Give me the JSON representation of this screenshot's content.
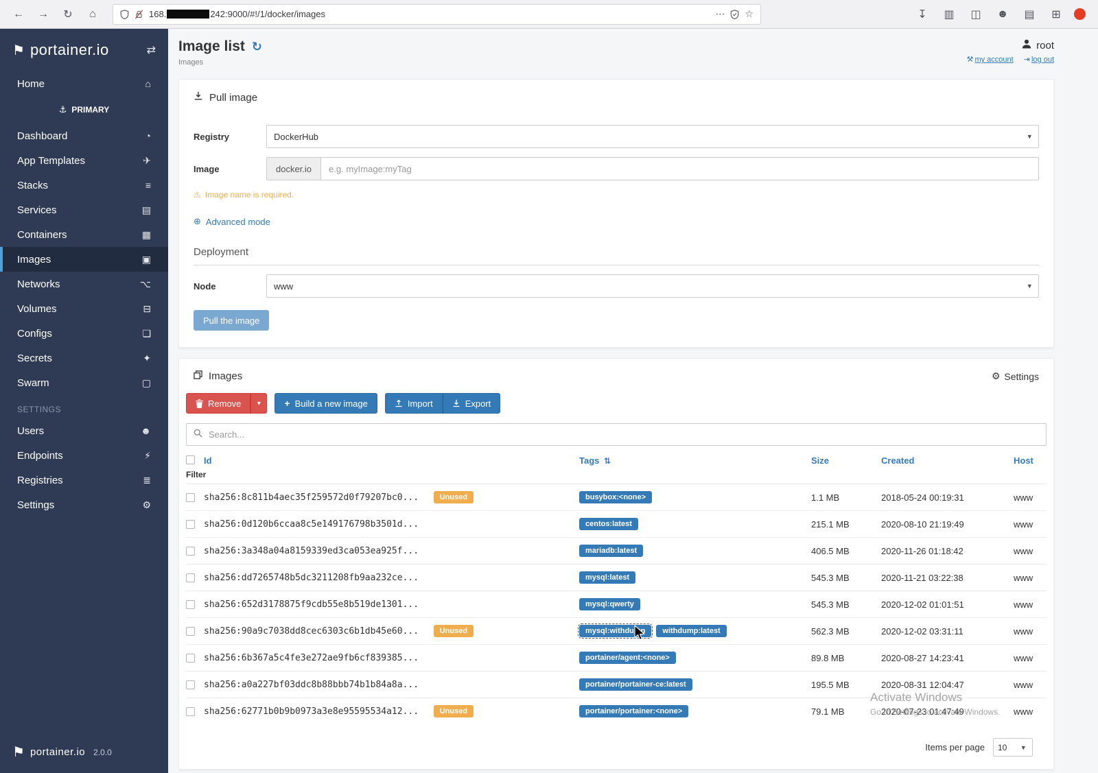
{
  "browser": {
    "url_prefix": "168.",
    "url_suffix": "242:9000/#!/1/docker/images"
  },
  "icons": {
    "back": "←",
    "forward": "→",
    "reload": "↻",
    "nav_home": "⌂",
    "dots": "⋯",
    "star": "☆",
    "downloads": "↧",
    "library": "▥",
    "sidebars": "◫",
    "account": "☻",
    "bookmark": "▤",
    "extensions": "⊞",
    "flag": "⚑",
    "exchange": "⇄",
    "home": "⌂",
    "anchor": "⚓",
    "dashboard": "◔",
    "app_templates": "✈",
    "stacks": "≡",
    "services": "▤",
    "containers": "▦",
    "images": "▣",
    "networks": "⌥",
    "volumes": "⊟",
    "configs": "❏",
    "secrets": "✦",
    "swarm": "▢",
    "users": "☻",
    "endpoints": "⚡",
    "registries": "≣",
    "settings": "⚙",
    "refresh": "↻",
    "wrench": "⚒",
    "logout": "⇥",
    "globe": "⊕",
    "warning": "⚠",
    "gear": "⚙",
    "sort": "⇅",
    "caret": "▾",
    "plus": "+"
  },
  "sidebar": {
    "logo_text": "portainer.io",
    "home_label": "Home",
    "cluster_label": "PRIMARY",
    "menu_items": [
      {
        "label": "Dashboard",
        "icon": "dashboard",
        "active": false
      },
      {
        "label": "App Templates",
        "icon": "app_templates",
        "active": false
      },
      {
        "label": "Stacks",
        "icon": "stacks",
        "active": false
      },
      {
        "label": "Services",
        "icon": "services",
        "active": false
      },
      {
        "label": "Containers",
        "icon": "containers",
        "active": false
      },
      {
        "label": "Images",
        "icon": "images",
        "active": true
      },
      {
        "label": "Networks",
        "icon": "networks",
        "active": false
      },
      {
        "label": "Volumes",
        "icon": "volumes",
        "active": false
      },
      {
        "label": "Configs",
        "icon": "configs",
        "active": false
      },
      {
        "label": "Secrets",
        "icon": "secrets",
        "active": false
      },
      {
        "label": "Swarm",
        "icon": "swarm",
        "active": false
      }
    ],
    "settings_header": "SETTINGS",
    "settings_items": [
      {
        "label": "Users",
        "icon": "users",
        "active": false
      },
      {
        "label": "Endpoints",
        "icon": "endpoints",
        "active": false
      },
      {
        "label": "Registries",
        "icon": "registries",
        "active": false
      },
      {
        "label": "Settings",
        "icon": "settings",
        "active": false
      }
    ],
    "footer_logo_text": "portainer.io",
    "version": "2.0.0"
  },
  "header": {
    "title": "Image list",
    "breadcrumb": "Images",
    "username": "root",
    "my_account_label": "my account",
    "log_out_label": "log out"
  },
  "pull_image": {
    "panel_title": "Pull image",
    "registry_label": "Registry",
    "registry_value": "DockerHub",
    "image_label": "Image",
    "image_addon": "docker.io",
    "image_placeholder": "e.g. myImage:myTag",
    "warning_text": "Image name is required.",
    "advanced_mode_label": "Advanced mode",
    "deployment_title": "Deployment",
    "node_label": "Node",
    "node_value": "www",
    "submit_label": "Pull the image"
  },
  "images_panel": {
    "panel_title": "Images",
    "settings_label": "Settings",
    "remove_label": "Remove",
    "build_label": "Build a new image",
    "import_label": "Import",
    "export_label": "Export",
    "search_placeholder": "Search...",
    "unused_label": "Unused",
    "columns": {
      "id": "Id",
      "filter": "Filter",
      "tags": "Tags",
      "size": "Size",
      "created": "Created",
      "host": "Host"
    },
    "rows": [
      {
        "id": "sha256:8c811b4aec35f259572d0f79207bc0...",
        "unused": true,
        "tags": [
          {
            "label": "busybox:<none>"
          }
        ],
        "size": "1.1 MB",
        "created": "2018-05-24 00:19:31",
        "host": "www"
      },
      {
        "id": "sha256:0d120b6ccaa8c5e149176798b3501d...",
        "unused": false,
        "tags": [
          {
            "label": "centos:latest"
          }
        ],
        "size": "215.1 MB",
        "created": "2020-08-10 21:19:49",
        "host": "www"
      },
      {
        "id": "sha256:3a348a04a8159339ed3ca053ea925f...",
        "unused": false,
        "tags": [
          {
            "label": "mariadb:latest"
          }
        ],
        "size": "406.5 MB",
        "created": "2020-11-26 01:18:42",
        "host": "www"
      },
      {
        "id": "sha256:dd7265748b5dc3211208fb9aa232ce...",
        "unused": false,
        "tags": [
          {
            "label": "mysql:latest"
          }
        ],
        "size": "545.3 MB",
        "created": "2020-11-21 03:22:38",
        "host": "www"
      },
      {
        "id": "sha256:652d3178875f9cdb55e8b519de1301...",
        "unused": false,
        "tags": [
          {
            "label": "mysql:qwerty"
          }
        ],
        "size": "545.3 MB",
        "created": "2020-12-02 01:01:51",
        "host": "www"
      },
      {
        "id": "sha256:90a9c7038dd8cec6303c6b1db45e60...",
        "unused": true,
        "tags": [
          {
            "label": "mysql:withdump",
            "focused": true
          },
          {
            "label": "withdump:latest"
          }
        ],
        "size": "562.3 MB",
        "created": "2020-12-02 03:31:11",
        "host": "www"
      },
      {
        "id": "sha256:6b367a5c4fe3e272ae9fb6cf839385...",
        "unused": false,
        "tags": [
          {
            "label": "portainer/agent:<none>"
          }
        ],
        "size": "89.8 MB",
        "created": "2020-08-27 14:23:41",
        "host": "www"
      },
      {
        "id": "sha256:a0a227bf03ddc8b88bbb74b1b84a8a...",
        "unused": false,
        "tags": [
          {
            "label": "portainer/portainer-ce:latest"
          }
        ],
        "size": "195.5 MB",
        "created": "2020-08-31 12:04:47",
        "host": "www"
      },
      {
        "id": "sha256:62771b0b9b0973a3e8e95595534a12...",
        "unused": true,
        "tags": [
          {
            "label": "portainer/portainer:<none>"
          }
        ],
        "size": "79.1 MB",
        "created": "2020-07-23 01:47:49",
        "host": "www"
      }
    ],
    "items_per_page_label": "Items per page",
    "items_per_page_value": "10"
  },
  "watermark": {
    "line1": "Activate Windows",
    "line2": "Go to Settings to activate Windows."
  },
  "colors": {
    "primary": "#337ab7",
    "danger": "#d9534f",
    "warning": "#f0ad4e",
    "sidebar_bg": "#2f3b54"
  }
}
